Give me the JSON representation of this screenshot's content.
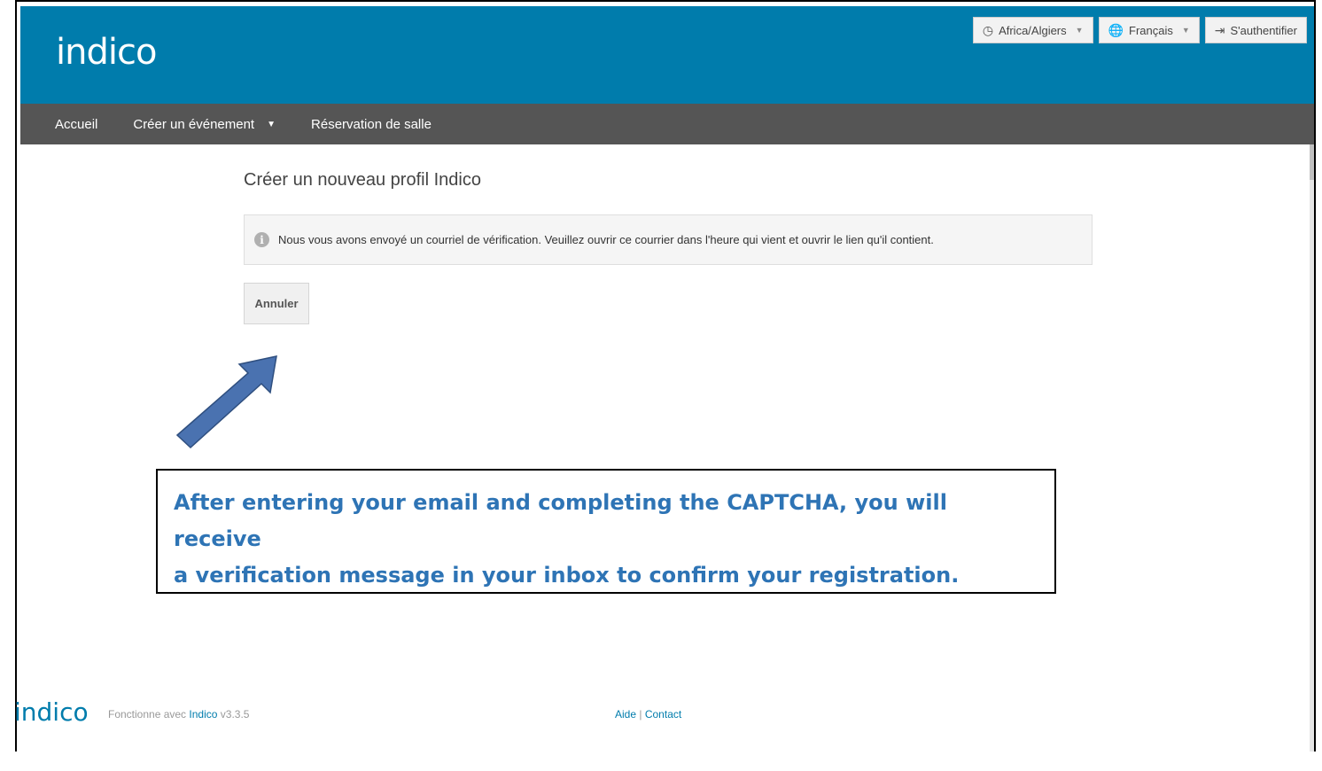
{
  "header": {
    "logo_text": "indico",
    "timezone_label": "Africa/Algiers",
    "language_label": "Français",
    "login_label": "S'authentifier"
  },
  "nav": {
    "items": [
      {
        "label": "Accueil"
      },
      {
        "label": "Créer un événement"
      },
      {
        "label": "Réservation de salle"
      }
    ]
  },
  "main": {
    "title": "Créer un nouveau profil Indico",
    "alert_text": "Nous vous avons envoyé un courriel de vérification. Veuillez ouvrir ce courrier dans l'heure qui vient et ouvrir le lien qu'il contient.",
    "cancel_label": "Annuler"
  },
  "callout": {
    "line1": "After entering your email and completing the CAPTCHA, you will receive",
    "line2": "a verification message in your inbox to confirm your registration."
  },
  "footer": {
    "logo_text": "indico",
    "powered_prefix": "Fonctionne avec",
    "powered_link": "Indico",
    "powered_version": "v3.3.5",
    "help_label": "Aide",
    "separator": "|",
    "contact_label": "Contact"
  },
  "colors": {
    "brand": "#007cac",
    "nav_bg": "#555555",
    "callout_text": "#2e74b5",
    "arrow_fill": "#4a72b0"
  }
}
